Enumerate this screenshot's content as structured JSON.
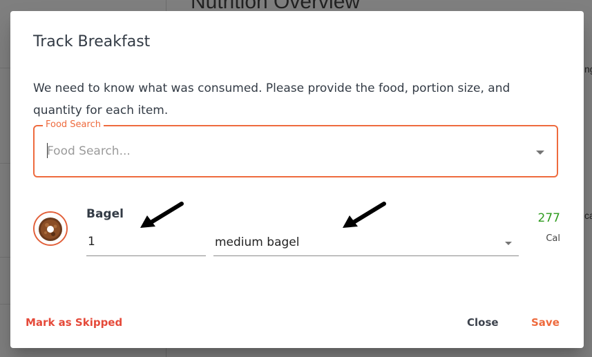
{
  "background": {
    "page_title": "Nutrition Overview",
    "fragment_1": "ng",
    "fragment_2": "ca"
  },
  "dialog": {
    "title": "Track Breakfast",
    "description": "We need to know what was consumed. Please provide the food, portion size, and quantity for each item.",
    "search": {
      "label": "Food Search",
      "placeholder": "Food Search...",
      "value": ""
    },
    "item": {
      "name": "Bagel",
      "quantity": "1",
      "portion": "medium bagel",
      "calories": "277",
      "calorie_unit": "Cal",
      "icon": "bagel-image"
    },
    "actions": {
      "skip": "Mark as Skipped",
      "close": "Close",
      "save": "Save"
    }
  },
  "colors": {
    "accent": "#ee6a3d",
    "danger": "#e54a3a",
    "calories": "#2e9b1e",
    "overlay": "rgba(0,0,0,0.5)"
  }
}
